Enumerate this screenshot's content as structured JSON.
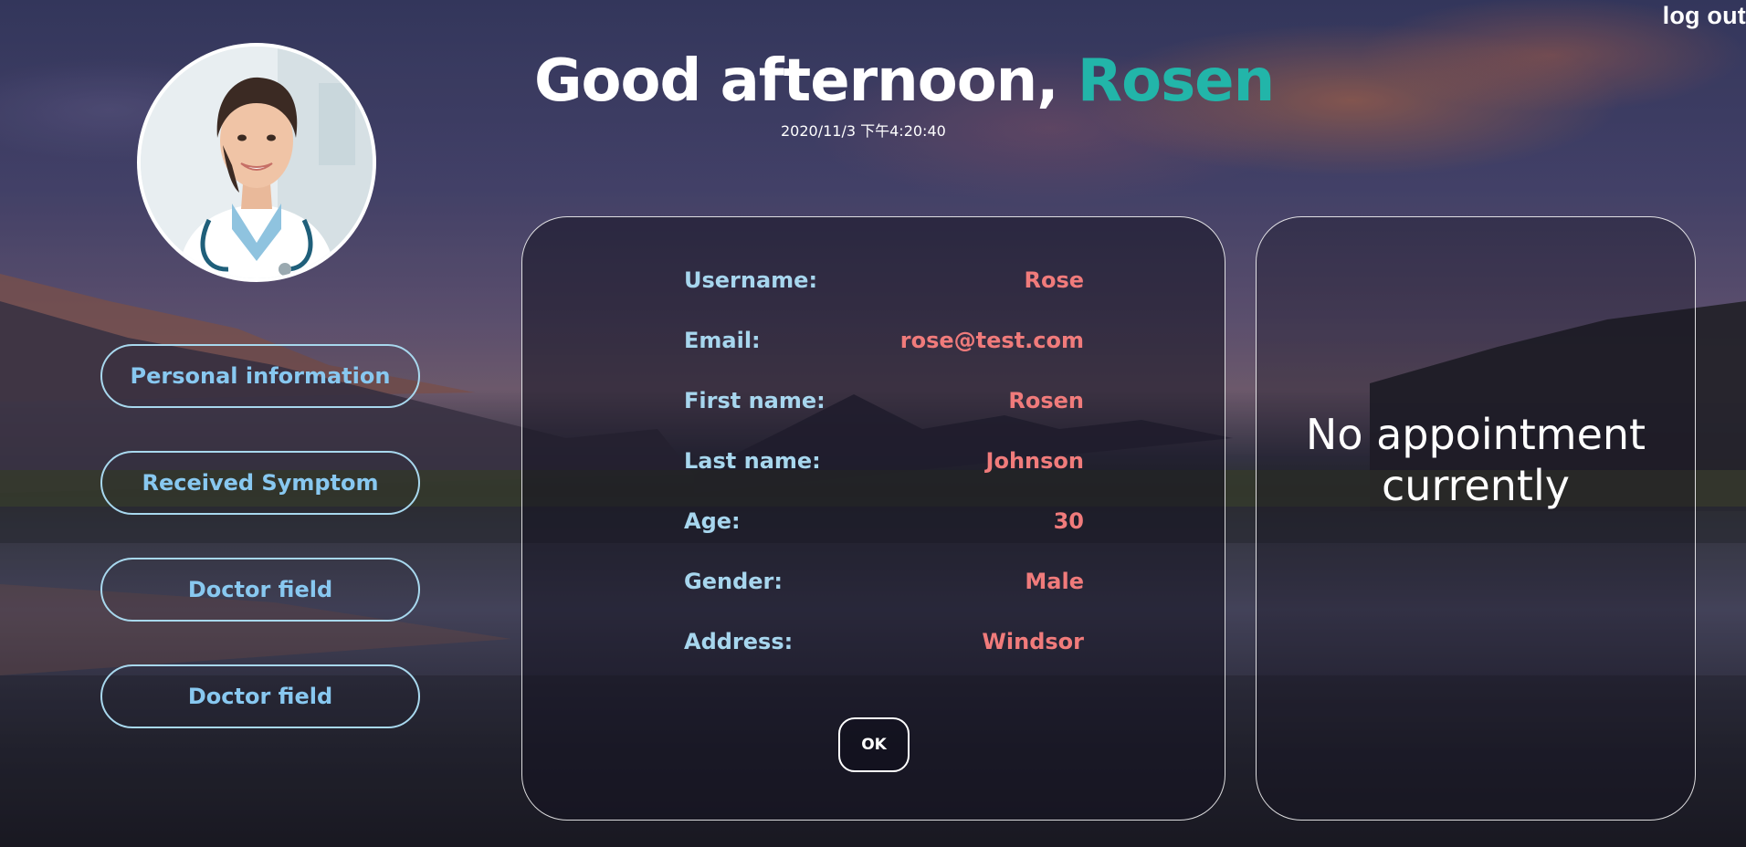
{
  "header": {
    "greeting_prefix": "Good afternoon,",
    "greeting_name": "Rosen",
    "datetime": "2020/11/3 下午4:20:40",
    "logout_label": "log out"
  },
  "sidebar": {
    "items": [
      {
        "label": "Personal information"
      },
      {
        "label": "Received Symptom"
      },
      {
        "label": "Doctor field"
      },
      {
        "label": "Doctor field"
      }
    ]
  },
  "profile": {
    "rows": [
      {
        "label": "Username:",
        "value": "Rose"
      },
      {
        "label": "Email:",
        "value": "rose@test.com"
      },
      {
        "label": "First name:",
        "value": "Rosen"
      },
      {
        "label": "Last name:",
        "value": "Johnson"
      },
      {
        "label": "Age:",
        "value": "30"
      },
      {
        "label": "Gender:",
        "value": "Male"
      },
      {
        "label": "Address:",
        "value": "Windsor"
      }
    ],
    "ok_label": "OK"
  },
  "appointment": {
    "message": "No appointment currently"
  },
  "colors": {
    "accent_name": "#22b5a9",
    "label": "#a7d6ee",
    "value": "#f07b7b",
    "nav_text": "#88c8f0"
  }
}
